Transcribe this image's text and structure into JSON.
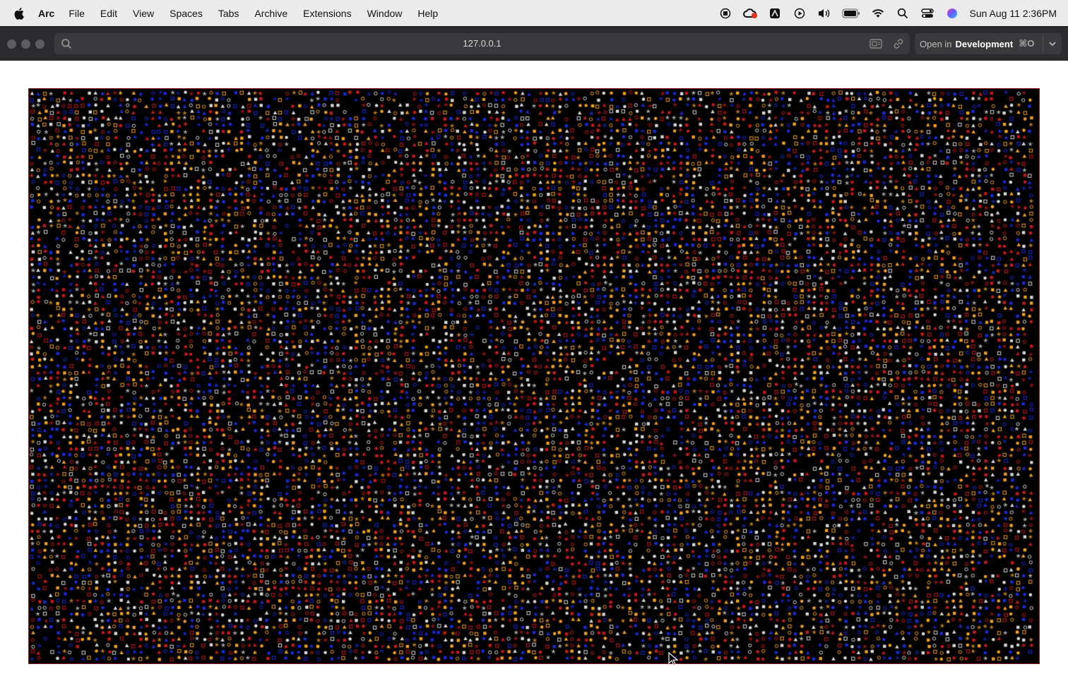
{
  "menubar": {
    "app_name": "Arc",
    "items": [
      "File",
      "Edit",
      "View",
      "Spaces",
      "Tabs",
      "Archive",
      "Extensions",
      "Window",
      "Help"
    ],
    "status_icons": [
      "record-icon",
      "creative-cloud-icon",
      "arc-drive-icon",
      "play-icon",
      "volume-icon",
      "battery-icon",
      "wifi-icon",
      "spotlight-icon",
      "control-center-icon",
      "siri-icon"
    ],
    "clock": "Sun Aug 11  2:36PM"
  },
  "toolbar": {
    "url": "127.0.0.1",
    "open_in_label": "Open in",
    "open_in_target": "Development",
    "open_in_shortcut": "⌘O"
  },
  "canvas": {
    "background": "#000000",
    "border_color": "#8b1a1a",
    "shape_colors": [
      "#f0a020",
      "#c41a1a",
      "#1a2ad6",
      "#d8d8d8"
    ],
    "shape_kinds": [
      "circle",
      "ring",
      "square",
      "square-outline",
      "triangle",
      "star"
    ]
  }
}
